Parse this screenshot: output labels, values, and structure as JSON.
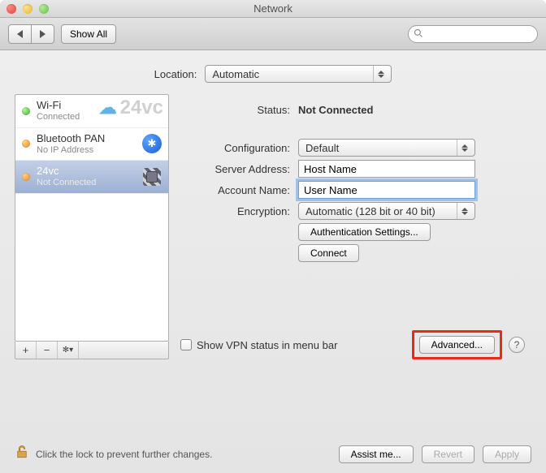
{
  "window": {
    "title": "Network"
  },
  "toolbar": {
    "show_all": "Show All",
    "search_placeholder": ""
  },
  "location": {
    "label": "Location:",
    "value": "Automatic"
  },
  "sidebar": {
    "items": [
      {
        "name": "Wi-Fi",
        "status": "Connected",
        "dot": "green",
        "icon": "wifi"
      },
      {
        "name": "Bluetooth PAN",
        "status": "No IP Address",
        "dot": "orange",
        "icon": "bluetooth"
      },
      {
        "name": "24vc",
        "status": "Not Connected",
        "dot": "orange",
        "icon": "lock",
        "selected": true
      }
    ],
    "watermark": "24vc"
  },
  "panel": {
    "status_label": "Status:",
    "status_value": "Not Connected",
    "config_label": "Configuration:",
    "config_value": "Default",
    "server_label": "Server Address:",
    "server_value": "Host Name",
    "account_label": "Account Name:",
    "account_value": "User Name",
    "encryption_label": "Encryption:",
    "encryption_value": "Automatic (128 bit or 40 bit)",
    "auth_settings": "Authentication Settings...",
    "connect": "Connect",
    "menubar_checkbox": "Show VPN status in menu bar",
    "advanced": "Advanced...",
    "help": "?"
  },
  "footer": {
    "lock_text": "Click the lock to prevent further changes.",
    "assist": "Assist me...",
    "revert": "Revert",
    "apply": "Apply"
  }
}
